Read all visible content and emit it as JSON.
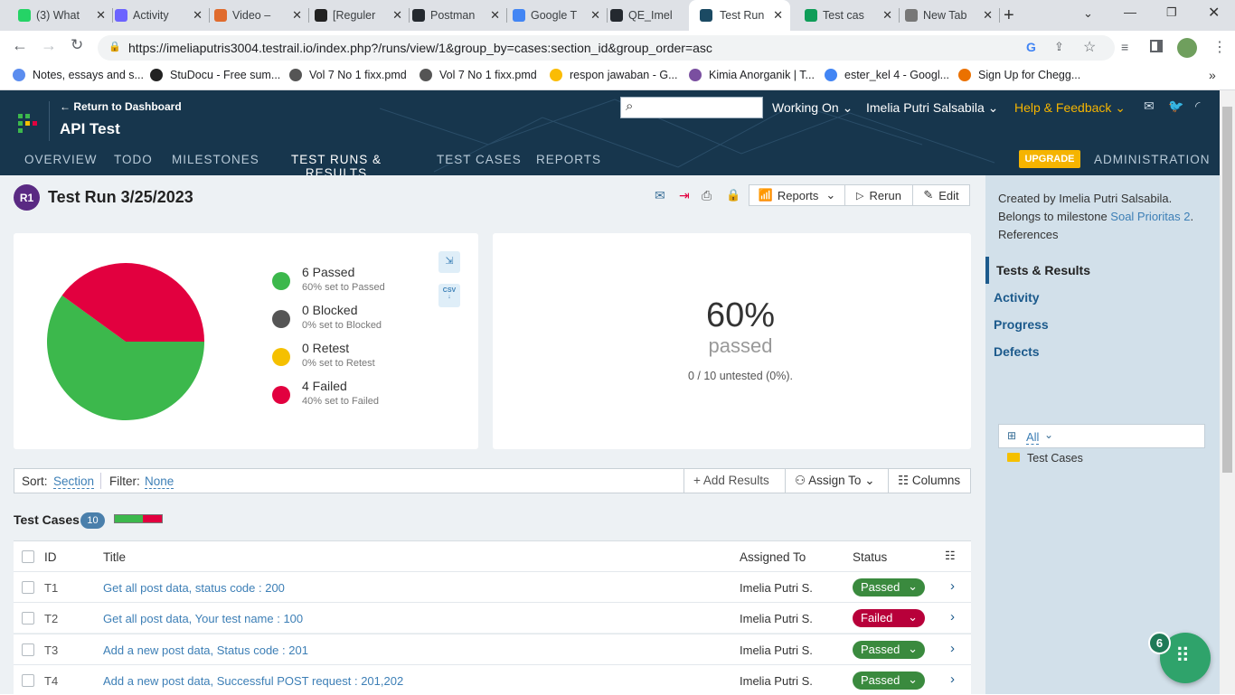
{
  "browser": {
    "tabs": [
      {
        "title": "(3) What",
        "color": "#25d366"
      },
      {
        "title": "Activity",
        "color": "#6c63ff"
      },
      {
        "title": "Video –",
        "color": "#e06b2d"
      },
      {
        "title": "[Reguler",
        "color": "#222"
      },
      {
        "title": "Postman",
        "color": "#24292f"
      },
      {
        "title": "Google T",
        "color": "#4285f4"
      },
      {
        "title": "QE_Imel",
        "color": "#24292f"
      },
      {
        "title": "Test Run",
        "color": "#1b4a63"
      },
      {
        "title": "Test cas",
        "color": "#0f9d58"
      },
      {
        "title": "New Tab",
        "color": "#777"
      }
    ],
    "url": "https://imeliaputris3004.testrail.io/index.php?/runs/view/1&group_by=cases:section_id&group_order=asc",
    "bookmarks": [
      {
        "label": "Notes, essays and s...",
        "color": "#5b8def"
      },
      {
        "label": "StuDocu - Free sum...",
        "color": "#222"
      },
      {
        "label": "Vol 7 No 1 fixx.pmd",
        "color": "#555"
      },
      {
        "label": "Vol 7 No 1 fixx.pmd",
        "color": "#555"
      },
      {
        "label": "respon jawaban - G...",
        "color": "#fbbc04"
      },
      {
        "label": "Kimia Anorganik | T...",
        "color": "#7a4fa0"
      },
      {
        "label": "ester_kel 4 - Googl...",
        "color": "#4285f4"
      },
      {
        "label": "Sign Up for Chegg...",
        "color": "#eb7100"
      }
    ]
  },
  "header": {
    "back_link": "← Return to Dashboard",
    "project": "API Test",
    "working_on": "Working On",
    "user": "Imelia Putri Salsabila",
    "help": "Help & Feedback",
    "upgrade": "UPGRADE",
    "admin": "ADMINISTRATION",
    "nav": [
      "OVERVIEW",
      "TODO",
      "MILESTONES",
      "TEST RUNS & RESULTS",
      "TEST CASES",
      "REPORTS"
    ]
  },
  "run": {
    "badge": "R1",
    "title": "Test Run 3/25/2023",
    "reports_btn": "Reports",
    "rerun_btn": "Rerun",
    "edit_btn": "Edit"
  },
  "chart_data": {
    "type": "pie",
    "categories": [
      "Passed",
      "Blocked",
      "Retest",
      "Failed"
    ],
    "values": [
      6,
      0,
      0,
      4
    ],
    "colors": [
      "#3cb84c",
      "#555555",
      "#f5c000",
      "#e2003f"
    ]
  },
  "legend": [
    {
      "name": "6 Passed",
      "sub": "60% set to Passed",
      "color": "#3cb84c"
    },
    {
      "name": "0 Blocked",
      "sub": "0% set to Blocked",
      "color": "#555555"
    },
    {
      "name": "0 Retest",
      "sub": "0% set to Retest",
      "color": "#f5c000"
    },
    {
      "name": "4 Failed",
      "sub": "40% set to Failed",
      "color": "#e2003f"
    }
  ],
  "csv_label": "CSV",
  "summary": {
    "percent": "60%",
    "passed": "passed",
    "untested": "0 / 10 untested (0%)."
  },
  "toolbar": {
    "sort_label": "Sort:",
    "sort_value": "Section",
    "filter_label": "Filter:",
    "filter_value": "None",
    "add_results": "Add Results",
    "assign_to": "Assign To",
    "columns": "Columns"
  },
  "section": {
    "title": "Test Cases",
    "count": "10",
    "progress_passed": 0.6
  },
  "table": {
    "headers": [
      "ID",
      "Title",
      "Assigned To",
      "Status"
    ],
    "rows": [
      {
        "id": "T1",
        "title": "Get all post data, status code : 200",
        "assigned": "Imelia Putri S.",
        "status": "Passed",
        "color": "#3a8a3e"
      },
      {
        "id": "T2",
        "title": "Get all post data, Your test name : 100",
        "assigned": "Imelia Putri S.",
        "status": "Failed",
        "color": "#b8003a"
      },
      {
        "id": "T3",
        "title": "Add a new post data, Status code : 201",
        "assigned": "Imelia Putri S.",
        "status": "Passed",
        "color": "#3a8a3e"
      },
      {
        "id": "T4",
        "title": "Add a new post data, Successful POST request : 201,202",
        "assigned": "Imelia Putri S.",
        "status": "Passed",
        "color": "#3a8a3e"
      }
    ]
  },
  "sidebar": {
    "created_by": "Created by Imelia Putri Salsabila.",
    "belongs": "Belongs to milestone ",
    "milestone": "Soal Prioritas 2",
    "references": "References",
    "links": [
      "Tests & Results",
      "Activity",
      "Progress",
      "Defects"
    ],
    "tree_filter": "All",
    "tree_item": "Test Cases"
  },
  "fab_count": "6"
}
